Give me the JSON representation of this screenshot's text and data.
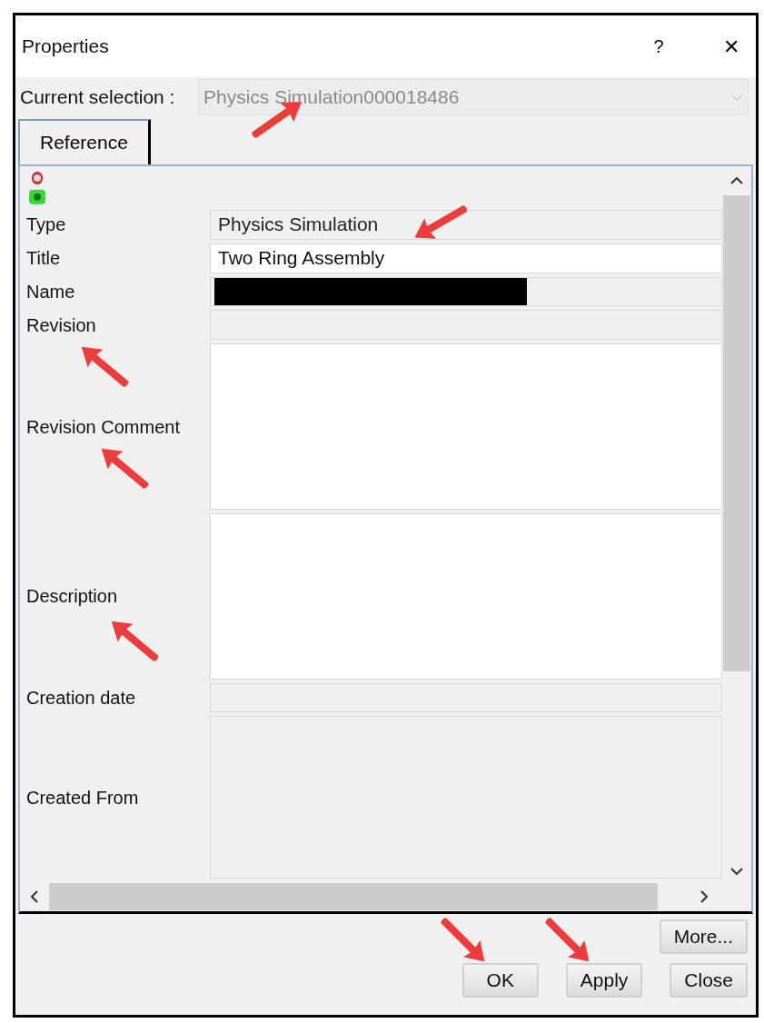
{
  "window": {
    "title": "Properties",
    "help": "?",
    "close": "✕"
  },
  "current_selection": {
    "label": "Current selection :",
    "value": "Physics Simulation000018486"
  },
  "tabs": [
    {
      "label": "Reference",
      "selected": true
    }
  ],
  "fields": [
    {
      "label": "Type",
      "value": "Physics Simulation",
      "kind": "readonly"
    },
    {
      "label": "Title",
      "value": "Two Ring Assembly",
      "kind": "editable"
    },
    {
      "label": "Name",
      "kind": "redacted"
    },
    {
      "label": "Revision",
      "kind": "readonly"
    },
    {
      "label": "Revision Comment",
      "kind": "editable_multiline"
    },
    {
      "label": "Description",
      "kind": "editable_multiline"
    },
    {
      "label": "Creation date",
      "kind": "readonly"
    },
    {
      "label": "Created From",
      "kind": "readonly_multiline"
    }
  ],
  "more_button": {
    "label": "More..."
  },
  "buttons": [
    {
      "label": "OK"
    },
    {
      "label": "Apply"
    },
    {
      "label": "Close"
    }
  ]
}
